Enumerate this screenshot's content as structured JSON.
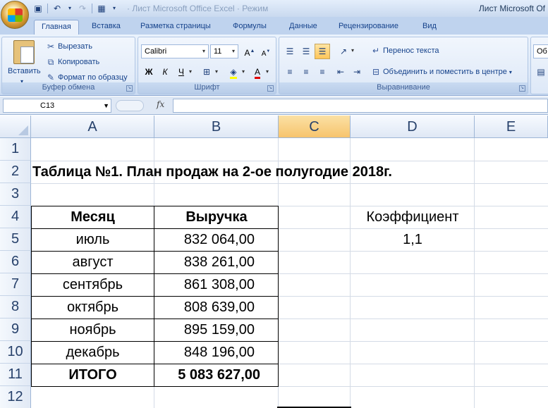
{
  "window": {
    "title": "Лист Microsoft Of",
    "doc_title_faded": "· Лист Microsoft Office Excel · Режим"
  },
  "tabs": [
    "Главная",
    "Вставка",
    "Разметка страницы",
    "Формулы",
    "Данные",
    "Рецензирование",
    "Вид"
  ],
  "clipboard": {
    "paste": "Вставить",
    "cut": "Вырезать",
    "copy": "Копировать",
    "format_painter": "Формат по образцу",
    "label": "Буфер обмена"
  },
  "font": {
    "name": "Calibri",
    "size": "11",
    "bold": "Ж",
    "italic": "К",
    "underline": "Ч",
    "label": "Шрифт"
  },
  "alignment": {
    "wrap": "Перенос текста",
    "merge": "Объединить и поместить в центре",
    "label": "Выравнивание"
  },
  "cut_off_next": "Об",
  "formula_bar": {
    "cell_ref": "C13",
    "fx": "fx",
    "value": ""
  },
  "columns": [
    "A",
    "B",
    "C",
    "D",
    "E"
  ],
  "rows": [
    "1",
    "2",
    "3",
    "4",
    "5",
    "6",
    "7",
    "8",
    "9",
    "10",
    "11",
    "12"
  ],
  "sheet": {
    "title": "Таблица №1. План продаж на 2-ое полугодие 2018г.",
    "header_month": "Месяц",
    "header_revenue": "Выручка",
    "months": [
      "июль",
      "август",
      "сентябрь",
      "октябрь",
      "ноябрь",
      "декабрь"
    ],
    "revenues": [
      "832 064,00",
      "838 261,00",
      "861 308,00",
      "808 639,00",
      "895 159,00",
      "848 196,00"
    ],
    "total_label": "ИТОГО",
    "total_value": "5 083 627,00",
    "coef_label": "Коэффициент",
    "coef_value": "1,1"
  },
  "colors": {
    "accent": "#f7c46d",
    "ribbon": "#dbe7f7",
    "header": "#dfe8f5"
  }
}
